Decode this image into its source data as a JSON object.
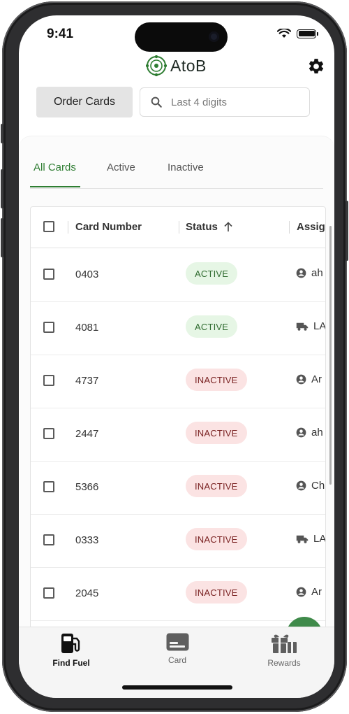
{
  "status_bar": {
    "time": "9:41"
  },
  "header": {
    "logo_text": "AtoB",
    "brand_color": "#2e7d32"
  },
  "toolbar": {
    "order_cards_label": "Order Cards",
    "search_placeholder": "Last 4 digits"
  },
  "tabs": [
    {
      "label": "All Cards",
      "selected": true
    },
    {
      "label": "Active",
      "selected": false
    },
    {
      "label": "Inactive",
      "selected": false
    }
  ],
  "table": {
    "columns": {
      "card_number": "Card Number",
      "status": "Status",
      "assigned": "Assig"
    },
    "rows": [
      {
        "card": "0403",
        "status": "ACTIVE",
        "status_kind": "active",
        "assign_icon": "person-icon",
        "assign_text": "ah"
      },
      {
        "card": "4081",
        "status": "ACTIVE",
        "status_kind": "active",
        "assign_icon": "truck-icon",
        "assign_text": "LA"
      },
      {
        "card": "4737",
        "status": "INACTIVE",
        "status_kind": "inactive",
        "assign_icon": "person-icon",
        "assign_text": "Ar"
      },
      {
        "card": "2447",
        "status": "INACTIVE",
        "status_kind": "inactive",
        "assign_icon": "person-icon",
        "assign_text": "ah"
      },
      {
        "card": "5366",
        "status": "INACTIVE",
        "status_kind": "inactive",
        "assign_icon": "person-icon",
        "assign_text": "Ch"
      },
      {
        "card": "0333",
        "status": "INACTIVE",
        "status_kind": "inactive",
        "assign_icon": "truck-icon",
        "assign_text": "LA"
      },
      {
        "card": "2045",
        "status": "INACTIVE",
        "status_kind": "inactive",
        "assign_icon": "person-icon",
        "assign_text": "Ar"
      }
    ]
  },
  "bottom_nav": [
    {
      "label": "Find Fuel",
      "icon": "fuel-pump-icon",
      "current": true
    },
    {
      "label": "Card",
      "icon": "credit-card-icon",
      "current": false
    },
    {
      "label": "Rewards",
      "icon": "gift-icon",
      "current": false
    }
  ],
  "colors": {
    "active_bg": "#e6f6e5",
    "inactive_bg": "#fbe3e3",
    "fab": "#3f8a4a"
  }
}
